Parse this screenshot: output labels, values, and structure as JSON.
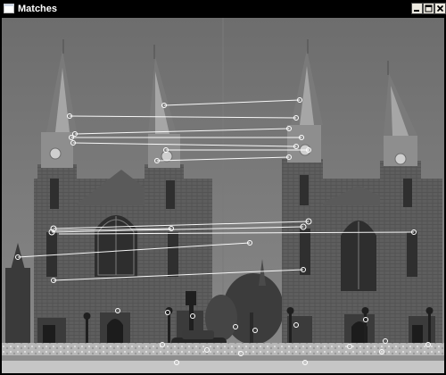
{
  "window": {
    "title": "Matches",
    "icon": "window-app-icon",
    "buttons": [
      {
        "name": "minimize",
        "icon": "minimize-icon"
      },
      {
        "name": "maximize",
        "icon": "maximize-icon"
      },
      {
        "name": "close",
        "icon": "close-icon"
      }
    ]
  },
  "image": {
    "description_icon": "church-matches-image",
    "stroke_color": "#ffffff",
    "keypoint_color": "#ffffff"
  }
}
